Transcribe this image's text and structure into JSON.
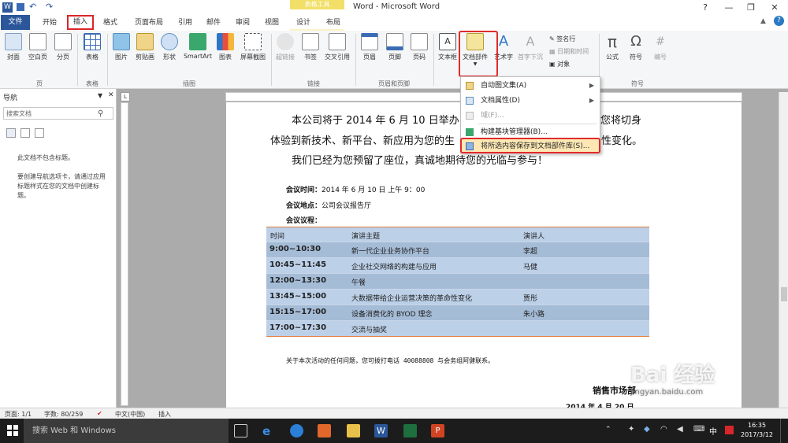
{
  "titlebar": {
    "title": "Word - Microsoft Word",
    "context_group": "表格工具",
    "minimize": "—",
    "restore": "❐",
    "close": "✕"
  },
  "tabs": [
    "文件",
    "开始",
    "插入",
    "格式",
    "页面布局",
    "引用",
    "邮件",
    "审阅",
    "视图",
    "设计",
    "布局"
  ],
  "ribbon": {
    "buttons": [
      "封面",
      "空白页",
      "分页",
      "表格",
      "图片",
      "剪贴画",
      "形状",
      "SmartArt",
      "图表",
      "屏幕截图",
      "超链接",
      "书签",
      "交叉引用",
      "页眉",
      "页脚",
      "页码",
      "文本框",
      "文档部件",
      "艺术字",
      "首字下沉",
      "签名行",
      "日期和时间",
      "对象",
      "公式",
      "符号",
      "编号"
    ],
    "groups": [
      "页",
      "表格",
      "插图",
      "链接",
      "页眉和页脚",
      "符号"
    ]
  },
  "menu": {
    "items": [
      "自动图文集(A)",
      "文档属性(D)",
      "域(F)...",
      "构建基块管理器(B)...",
      "将所选内容保存到文档部件库(S)..."
    ]
  },
  "nav": {
    "title": "导航",
    "search_placeholder": "搜索文档",
    "msg1": "此文档不包含标题。",
    "msg2": "要创建导航选项卡，请通过应用标题样式在您的文档中创建标题。"
  },
  "doc": {
    "line1": "本公司将于 2014 年 6 月 10 日举办",
    "line1_tail": "您将切身",
    "line2": "体验到新技术、新平台、新应用为您的生",
    "line2_tail": "性变化。",
    "line3": "我们已经为您预留了座位，真诚地期待您的光临与参与！",
    "time_label": "会议时间：",
    "time_value": "2014 年 6 月 10 日 上午 9：00",
    "place_label": "会议地点：",
    "place_value": "公司会议报告厅",
    "agenda_label": "会议议程：",
    "footer_note": "关于本次活动的任何问题，您可拨打电话 40088808 与会务组阿健联系。",
    "sign": "销售市场部",
    "sign_date": "2014 年 4 月 20 日"
  },
  "table": {
    "headers": [
      "时间",
      "演讲主题",
      "演讲人"
    ],
    "rows": [
      [
        "9:00~10:30",
        "新一代企业业务协作平台",
        "李超"
      ],
      [
        "10:45~11:45",
        "企业社交网络的构建与应用",
        "马健"
      ],
      [
        "12:00~13:30",
        "午餐",
        ""
      ],
      [
        "13:45~15:00",
        "大数据带给企业运营决策的革命性变化",
        "贾彤"
      ],
      [
        "15:15~17:00",
        "设备消费化的 BYOD 理念",
        "朱小路"
      ],
      [
        "17:00~17:30",
        "交流与抽奖",
        ""
      ]
    ]
  },
  "status": {
    "page": "页面: 1/1",
    "words": "字数: 80/259",
    "lang": "中文(中国)",
    "mode": "插入"
  },
  "taskbar": {
    "search": "搜索 Web 和 Windows",
    "time": "16:35",
    "date": "2017/3/12",
    "ime": "中"
  },
  "watermark": {
    "text": "Bai 经验",
    "sub": "jingyan.baidu.com"
  },
  "colors": {
    "file_tab": "#2b579a",
    "highlight": "#e02b2b",
    "table_row_dark": "#a5bcd7",
    "table_row_light": "#bcd0e8"
  }
}
